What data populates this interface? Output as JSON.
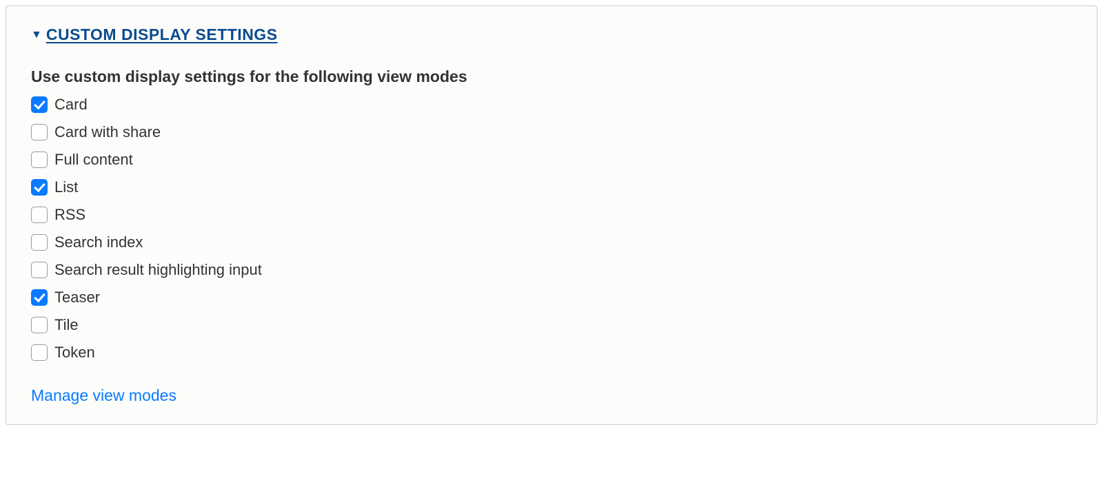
{
  "panel": {
    "title": "CUSTOM DISPLAY SETTINGS",
    "group_label": "Use custom display settings for the following view modes",
    "view_modes": [
      {
        "label": "Card",
        "checked": true
      },
      {
        "label": "Card with share",
        "checked": false
      },
      {
        "label": "Full content",
        "checked": false
      },
      {
        "label": "List",
        "checked": true
      },
      {
        "label": "RSS",
        "checked": false
      },
      {
        "label": "Search index",
        "checked": false
      },
      {
        "label": "Search result highlighting input",
        "checked": false
      },
      {
        "label": "Teaser",
        "checked": true
      },
      {
        "label": "Tile",
        "checked": false
      },
      {
        "label": "Token",
        "checked": false
      }
    ],
    "manage_link": "Manage view modes"
  }
}
